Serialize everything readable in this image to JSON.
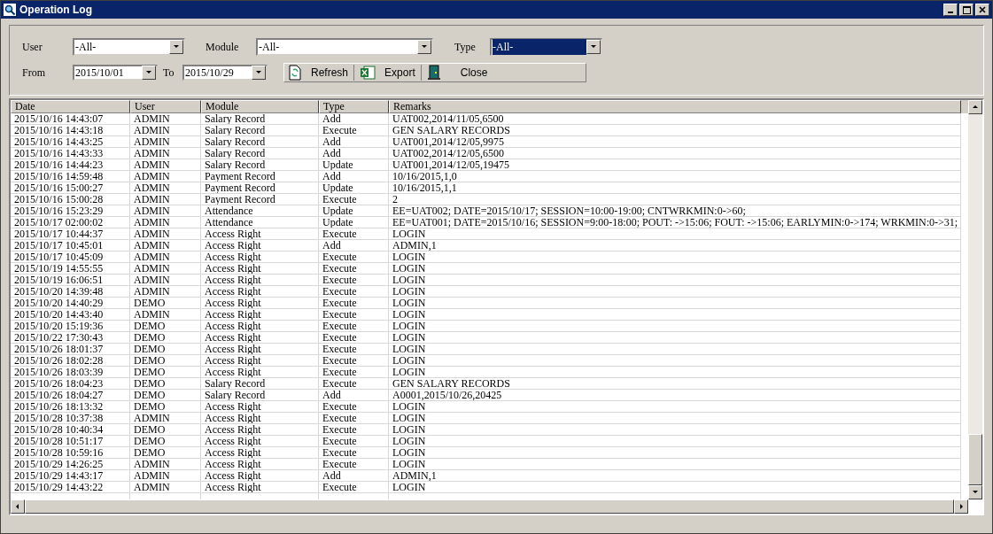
{
  "window": {
    "title": "Operation Log"
  },
  "filters": [
    {
      "label": "User",
      "value": "-All-",
      "focused": false,
      "kind": "wide"
    },
    {
      "label": "Module",
      "value": "-All-",
      "focused": false,
      "kind": "long"
    },
    {
      "label": "Type",
      "value": "-All-",
      "focused": true,
      "kind": "wide"
    }
  ],
  "dates": [
    {
      "label": "From",
      "value": "2015/10/01"
    },
    {
      "label": "To",
      "value": "2015/10/29"
    }
  ],
  "buttons": [
    {
      "label": "Refresh",
      "kind": "refresh"
    },
    {
      "label": "Export",
      "kind": "excel"
    },
    {
      "label": "Close",
      "kind": "exit"
    }
  ],
  "table": {
    "columns": [
      "Date",
      "User",
      "Module",
      "Type",
      "Remarks"
    ],
    "rows": [
      [
        "2015/10/16 14:43:07",
        "ADMIN",
        "Salary Record",
        "Add",
        "UAT002,2014/11/05,6500"
      ],
      [
        "2015/10/16 14:43:18",
        "ADMIN",
        "Salary Record",
        "Execute",
        "GEN SALARY RECORDS"
      ],
      [
        "2015/10/16 14:43:25",
        "ADMIN",
        "Salary Record",
        "Add",
        "UAT001,2014/12/05,9975"
      ],
      [
        "2015/10/16 14:43:33",
        "ADMIN",
        "Salary Record",
        "Add",
        "UAT002,2014/12/05,6500"
      ],
      [
        "2015/10/16 14:44:23",
        "ADMIN",
        "Salary Record",
        "Update",
        "UAT001,2014/12/05,19475"
      ],
      [
        "2015/10/16 14:59:48",
        "ADMIN",
        "Payment Record",
        "Add",
        "10/16/2015,1,0"
      ],
      [
        "2015/10/16 15:00:27",
        "ADMIN",
        "Payment Record",
        "Update",
        "10/16/2015,1,1"
      ],
      [
        "2015/10/16 15:00:28",
        "ADMIN",
        "Payment Record",
        "Execute",
        "2"
      ],
      [
        "2015/10/16 15:23:29",
        "ADMIN",
        "Attendance",
        "Update",
        "EE=UAT002;  DATE=2015/10/17;  SESSION=10:00-19:00;  CNTWRKMIN:0->60;"
      ],
      [
        "2015/10/17 02:00:02",
        "ADMIN",
        "Attendance",
        "Update",
        "EE=UAT001;  DATE=2015/10/16;  SESSION=9:00-18:00;  POUT:  ->15:06;  FOUT:  ->15:06;  EARLYMIN:0->174;  WRKMIN:0->31;"
      ],
      [
        "2015/10/17 10:44:37",
        "ADMIN",
        "Access Right",
        "Execute",
        "LOGIN"
      ],
      [
        "2015/10/17 10:45:01",
        "ADMIN",
        "Access Right",
        "Add",
        "ADMIN,1"
      ],
      [
        "2015/10/17 10:45:09",
        "ADMIN",
        "Access Right",
        "Execute",
        "LOGIN"
      ],
      [
        "2015/10/19 14:55:55",
        "ADMIN",
        "Access Right",
        "Execute",
        "LOGIN"
      ],
      [
        "2015/10/19 16:06:51",
        "ADMIN",
        "Access Right",
        "Execute",
        "LOGIN"
      ],
      [
        "2015/10/20 14:39:48",
        "ADMIN",
        "Access Right",
        "Execute",
        "LOGIN"
      ],
      [
        "2015/10/20 14:40:29",
        "DEMO",
        "Access Right",
        "Execute",
        "LOGIN"
      ],
      [
        "2015/10/20 14:43:40",
        "ADMIN",
        "Access Right",
        "Execute",
        "LOGIN"
      ],
      [
        "2015/10/20 15:19:36",
        "DEMO",
        "Access Right",
        "Execute",
        "LOGIN"
      ],
      [
        "2015/10/22 17:30:43",
        "DEMO",
        "Access Right",
        "Execute",
        "LOGIN"
      ],
      [
        "2015/10/26 18:01:37",
        "DEMO",
        "Access Right",
        "Execute",
        "LOGIN"
      ],
      [
        "2015/10/26 18:02:28",
        "DEMO",
        "Access Right",
        "Execute",
        "LOGIN"
      ],
      [
        "2015/10/26 18:03:39",
        "DEMO",
        "Access Right",
        "Execute",
        "LOGIN"
      ],
      [
        "2015/10/26 18:04:23",
        "DEMO",
        "Salary Record",
        "Execute",
        "GEN SALARY RECORDS"
      ],
      [
        "2015/10/26 18:04:27",
        "DEMO",
        "Salary Record",
        "Add",
        "A0001,2015/10/26,20425"
      ],
      [
        "2015/10/26 18:13:32",
        "DEMO",
        "Access Right",
        "Execute",
        "LOGIN"
      ],
      [
        "2015/10/28 10:37:38",
        "ADMIN",
        "Access Right",
        "Execute",
        "LOGIN"
      ],
      [
        "2015/10/28 10:40:34",
        "DEMO",
        "Access Right",
        "Execute",
        "LOGIN"
      ],
      [
        "2015/10/28 10:51:17",
        "DEMO",
        "Access Right",
        "Execute",
        "LOGIN"
      ],
      [
        "2015/10/28 10:59:16",
        "DEMO",
        "Access Right",
        "Execute",
        "LOGIN"
      ],
      [
        "2015/10/29 14:26:25",
        "ADMIN",
        "Access Right",
        "Execute",
        "LOGIN"
      ],
      [
        "2015/10/29 14:43:17",
        "ADMIN",
        "Access Right",
        "Add",
        "ADMIN,1"
      ],
      [
        "2015/10/29 14:43:22",
        "ADMIN",
        "Access Right",
        "Execute",
        "LOGIN"
      ]
    ]
  }
}
